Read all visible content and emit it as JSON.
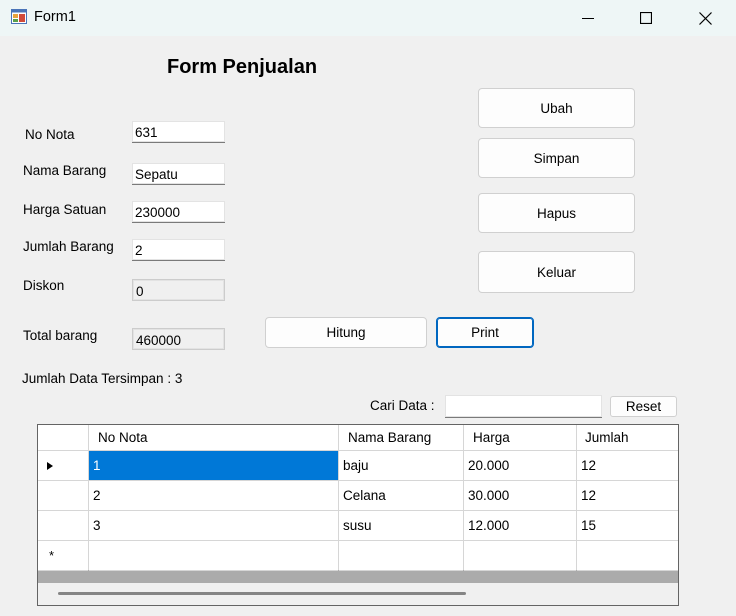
{
  "window": {
    "title": "Form1"
  },
  "form": {
    "title": "Form Penjualan",
    "fields": {
      "no_nota": {
        "label": "No Nota",
        "value": "631"
      },
      "nama_barang": {
        "label": "Nama Barang",
        "value": "Sepatu"
      },
      "harga_satuan": {
        "label": "Harga Satuan",
        "value": "230000"
      },
      "jumlah_barang": {
        "label": "Jumlah Barang",
        "value": "2"
      },
      "diskon": {
        "label": "Diskon",
        "value": "0"
      },
      "total_barang": {
        "label": "Total barang",
        "value": "460000"
      }
    },
    "status_text": "Jumlah Data Tersimpan : 3"
  },
  "buttons": {
    "ubah": "Ubah",
    "simpan": "Simpan",
    "hapus": "Hapus",
    "keluar": "Keluar",
    "hitung": "Hitung",
    "print": "Print",
    "reset": "Reset"
  },
  "search": {
    "label": "Cari Data :",
    "value": ""
  },
  "grid": {
    "columns": [
      "No Nota",
      "Nama Barang",
      "Harga",
      "Jumlah"
    ],
    "rows": [
      [
        "1",
        "baju",
        "20.000",
        "12"
      ],
      [
        "2",
        "Celana",
        "30.000",
        "12"
      ],
      [
        "3",
        "susu",
        "12.000",
        "15"
      ]
    ],
    "new_row_marker": "*"
  }
}
